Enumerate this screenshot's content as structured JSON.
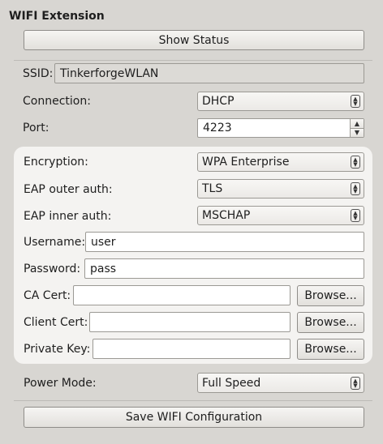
{
  "group": {
    "title": "WIFI Extension"
  },
  "show_status_button": "Show Status",
  "ssid": {
    "label": "SSID:",
    "value": "TinkerforgeWLAN"
  },
  "connection": {
    "label": "Connection:",
    "value": "DHCP"
  },
  "port": {
    "label": "Port:",
    "value": "4223"
  },
  "encryption": {
    "label": "Encryption:",
    "value": "WPA Enterprise"
  },
  "eap_outer": {
    "label": "EAP outer auth:",
    "value": "TLS"
  },
  "eap_inner": {
    "label": "EAP inner auth:",
    "value": "MSCHAP"
  },
  "username": {
    "label": "Username:",
    "value": "user"
  },
  "password": {
    "label": "Password:",
    "value": "pass"
  },
  "ca_cert": {
    "label": "CA Cert:",
    "value": "",
    "browse": "Browse..."
  },
  "client_cert": {
    "label": "Client Cert:",
    "value": "",
    "browse": "Browse..."
  },
  "private_key": {
    "label": "Private Key:",
    "value": "",
    "browse": "Browse..."
  },
  "power_mode": {
    "label": "Power Mode:",
    "value": "Full Speed"
  },
  "save_button": "Save WIFI Configuration",
  "icons": {
    "combo_arrows": "updown-chevron-icon",
    "spin_up": "spin-up-icon",
    "spin_down": "spin-down-icon"
  }
}
